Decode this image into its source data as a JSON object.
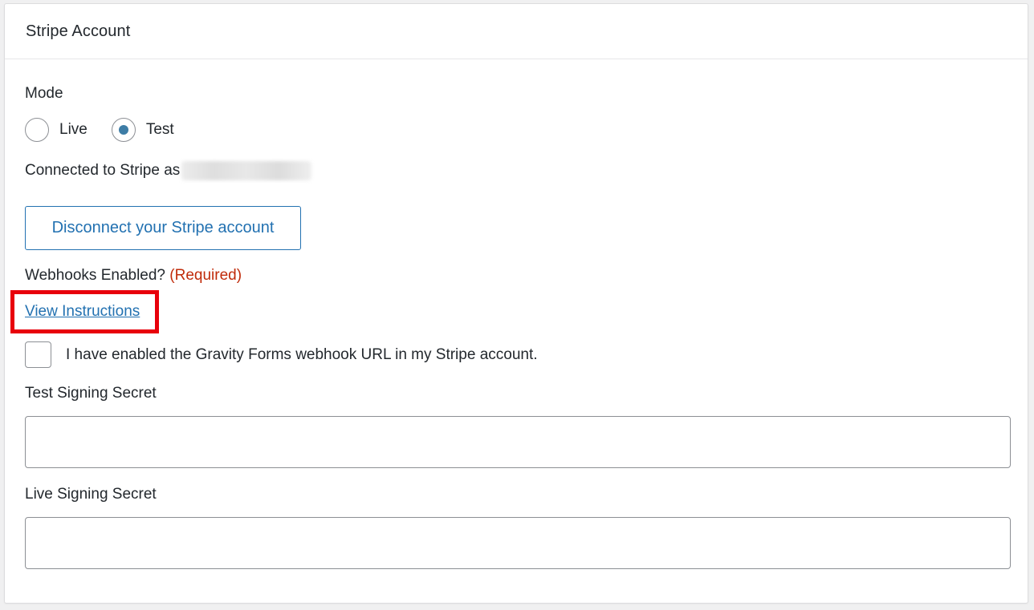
{
  "panel": {
    "title": "Stripe Account"
  },
  "mode": {
    "label": "Mode",
    "options": [
      {
        "label": "Live",
        "selected": false
      },
      {
        "label": "Test",
        "selected": true
      }
    ]
  },
  "connection": {
    "prefix": "Connected to Stripe as",
    "disconnect_label": "Disconnect your Stripe account"
  },
  "webhooks": {
    "label": "Webhooks Enabled?",
    "required_label": "(Required)",
    "instructions_link": "View Instructions",
    "checkbox_label": "I have enabled the Gravity Forms webhook URL in my Stripe account.",
    "checkbox_checked": false
  },
  "fields": {
    "test_signing_secret": {
      "label": "Test Signing Secret",
      "value": ""
    },
    "live_signing_secret": {
      "label": "Live Signing Secret",
      "value": ""
    }
  },
  "colors": {
    "accent": "#2271b1",
    "radio_selected": "#3e7da6",
    "required": "#c02b0a",
    "highlight": "#e8000b"
  }
}
